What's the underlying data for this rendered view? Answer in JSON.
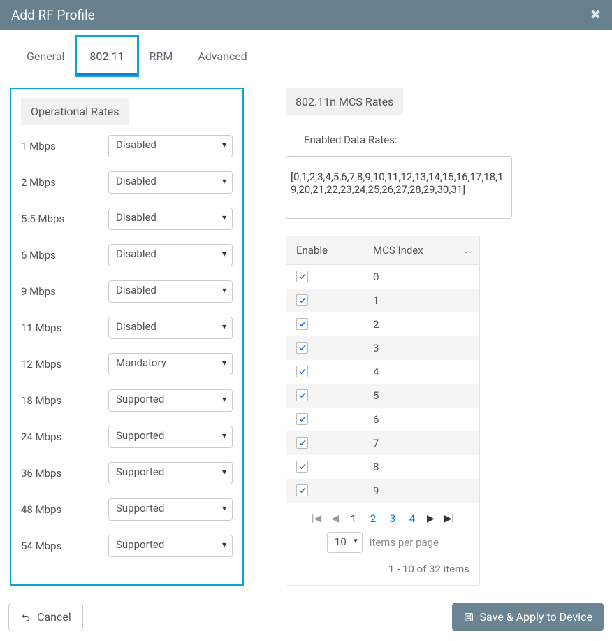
{
  "header": {
    "title": "Add RF Profile"
  },
  "tabs": {
    "items": [
      {
        "label": "General",
        "active": false,
        "highlight": false
      },
      {
        "label": "802.11",
        "active": true,
        "highlight": true
      },
      {
        "label": "RRM",
        "active": false,
        "highlight": false
      },
      {
        "label": "Advanced",
        "active": false,
        "highlight": false
      }
    ]
  },
  "operational": {
    "title": "Operational Rates",
    "rows": [
      {
        "label": "1 Mbps",
        "value": "Disabled"
      },
      {
        "label": "2 Mbps",
        "value": "Disabled"
      },
      {
        "label": "5.5 Mbps",
        "value": "Disabled"
      },
      {
        "label": "6 Mbps",
        "value": "Disabled"
      },
      {
        "label": "9 Mbps",
        "value": "Disabled"
      },
      {
        "label": "11 Mbps",
        "value": "Disabled"
      },
      {
        "label": "12 Mbps",
        "value": "Mandatory"
      },
      {
        "label": "18 Mbps",
        "value": "Supported"
      },
      {
        "label": "24 Mbps",
        "value": "Supported"
      },
      {
        "label": "36 Mbps",
        "value": "Supported"
      },
      {
        "label": "48 Mbps",
        "value": "Supported"
      },
      {
        "label": "54 Mbps",
        "value": "Supported"
      }
    ]
  },
  "mcs": {
    "title": "802.11n MCS Rates",
    "enabled_label": "Enabled Data Rates:",
    "enabled_list": "[0,1,2,3,4,5,6,7,8,9,10,11,12,13,14,15,16,17,18,19,20,21,22,23,24,25,26,27,28,29,30,31]",
    "cols": {
      "enable": "Enable",
      "index": "MCS Index"
    },
    "rows": [
      {
        "checked": true,
        "index": "0"
      },
      {
        "checked": true,
        "index": "1"
      },
      {
        "checked": true,
        "index": "2"
      },
      {
        "checked": true,
        "index": "3"
      },
      {
        "checked": true,
        "index": "4"
      },
      {
        "checked": true,
        "index": "5"
      },
      {
        "checked": true,
        "index": "6"
      },
      {
        "checked": true,
        "index": "7"
      },
      {
        "checked": true,
        "index": "8"
      },
      {
        "checked": true,
        "index": "9"
      }
    ],
    "pager": {
      "pages": [
        "1",
        "2",
        "3",
        "4"
      ],
      "active": "1",
      "per_page": "10",
      "per_page_label": "items per page",
      "summary": "1 - 10 of 32 items"
    }
  },
  "footer": {
    "cancel": "Cancel",
    "save": "Save & Apply to Device"
  }
}
